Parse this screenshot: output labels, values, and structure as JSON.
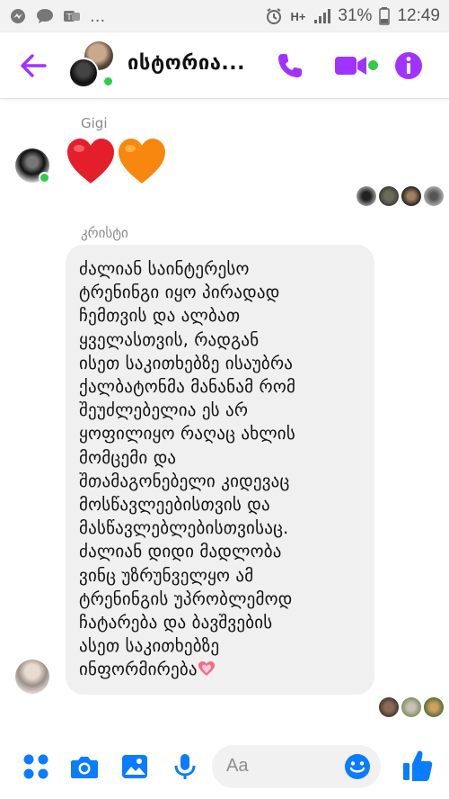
{
  "status_bar": {
    "battery": "31%",
    "time": "12:49",
    "network": "H+",
    "overflow": "..."
  },
  "header": {
    "title": "ისტორია...",
    "back_icon": "arrow-left-icon",
    "call_icon": "phone-icon",
    "video_icon": "video-camera-icon",
    "info_icon": "info-icon",
    "accent_color": "#a033ff"
  },
  "messages": [
    {
      "sender": "Gigi",
      "content": "❤️🧡",
      "type": "emoji"
    },
    {
      "sender": "კრისტი",
      "type": "text",
      "lines": [
        "ძალიან საინტერესო",
        "ტრენინგი იყო პირადად",
        "ჩემთვის და ალბათ",
        "ყველასთვის, რადგან",
        "ისეთ საკითხებზე ისაუბრა",
        "ქალბატონმა მანანამ რომ",
        "შეუძლებელია ეს არ",
        "ყოფილიყო რაღაც ახლის",
        "მომცემი და",
        "შთამაგონებელი კიდევაც",
        "მოსწავლეებისთვის და",
        "მასწავლებლებისთვისაც.",
        "ძალიან დიდი მადლობა",
        "ვინც უზრუნველყო ამ",
        "ტრენინგის უპრობლემოდ",
        "ჩატარება და ბავშვების",
        "ასეთ საკითხებზე",
        "ინფორმირება"
      ],
      "trailing_emoji": "💗"
    }
  ],
  "composer": {
    "placeholder": "Aa",
    "menu_icon": "grid-dots-icon",
    "camera_icon": "camera-icon",
    "gallery_icon": "image-icon",
    "mic_icon": "microphone-icon",
    "emoji_icon": "smiley-icon",
    "like_icon": "thumbs-up-icon",
    "accent_color": "#0a7cff"
  }
}
